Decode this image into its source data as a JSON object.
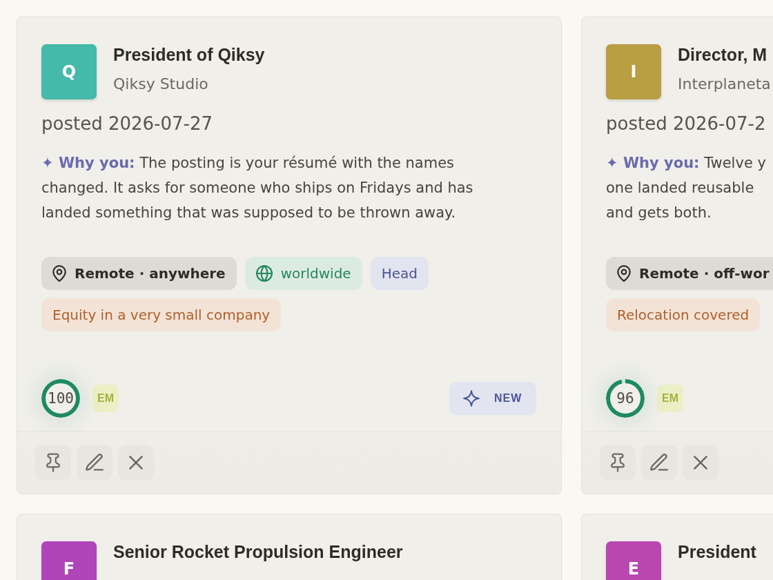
{
  "cards": [
    {
      "avatar": {
        "letter": "Q",
        "color": "#45b9aa"
      },
      "title": "President of Qiksy",
      "company": "Qiksy Studio",
      "posted": "posted 2026-07-27",
      "why_lines": [
        "**✦ Why you:** The posting is your résumé with the names",
        "changed. It asks for someone who ships on Fridays and has",
        "landed something that was supposed to be thrown away."
      ],
      "tags": [
        {
          "kind": "location",
          "label": "Remote · anywhere"
        },
        {
          "kind": "region",
          "label": "worldwide"
        },
        {
          "kind": "level",
          "label": "Head"
        },
        {
          "kind": "perk",
          "label": "Equity in a very small company"
        }
      ],
      "score": {
        "value": "100",
        "level": 1
      },
      "badge": "EM",
      "new_label": "NEW",
      "actions": [
        {
          "kind": "pin"
        },
        {
          "kind": "edit"
        },
        {
          "kind": "dismiss"
        }
      ]
    },
    {
      "avatar": {
        "letter": "I",
        "color": "#b99e43"
      },
      "title": "Director, M",
      "company": "Interplaneta",
      "posted": "posted 2026-07-2",
      "why_lines": [
        "**✦ Why you:** Twelve y",
        "one landed reusable",
        "and gets both."
      ],
      "tags": [
        {
          "kind": "location",
          "label": "Remote · off-wor"
        },
        {
          "kind": "perk",
          "label": "Relocation covered"
        }
      ],
      "score": {
        "value": "96",
        "level": 0.96
      },
      "badge": "EM",
      "actions": [
        {
          "kind": "pin"
        },
        {
          "kind": "edit"
        },
        {
          "kind": "dismiss"
        }
      ]
    },
    {
      "avatar": {
        "letter": "F",
        "color": "#b045b9"
      },
      "title": "Senior Rocket Propulsion Engineer"
    },
    {
      "avatar": {
        "letter": "E",
        "color": "#b946b1"
      },
      "title": "President"
    }
  ]
}
